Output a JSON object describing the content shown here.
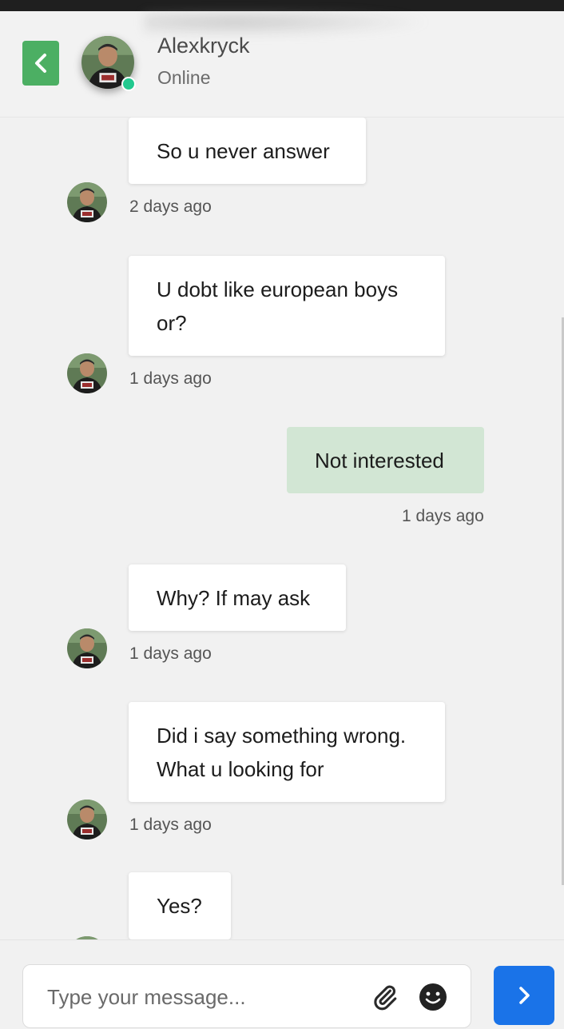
{
  "header": {
    "contact_name": "Alexkryck",
    "contact_status": "Online"
  },
  "messages": [
    {
      "text": "So u never answer",
      "time": "2 days ago",
      "direction": "received"
    },
    {
      "text": "U dobt like european boys or?",
      "time": "1 days ago",
      "direction": "received"
    },
    {
      "text": "Not interested",
      "time": "1 days ago",
      "direction": "sent"
    },
    {
      "text": "Why? If may ask",
      "time": "1 days ago",
      "direction": "received"
    },
    {
      "text": "Did i say something wrong. What u looking for",
      "time": "1 days ago",
      "direction": "received"
    },
    {
      "text": "Yes?",
      "time": "",
      "direction": "received"
    }
  ],
  "composer": {
    "placeholder": "Type your message..."
  },
  "colors": {
    "back_button": "#4caf63",
    "online_dot": "#22c98f",
    "sent_bubble": "#d2e6d4",
    "send_button": "#1a73e8"
  },
  "icons": {
    "back": "chevron-left-icon",
    "attach": "paperclip-icon",
    "emoji": "smiley-icon",
    "send": "chevron-right-icon"
  }
}
